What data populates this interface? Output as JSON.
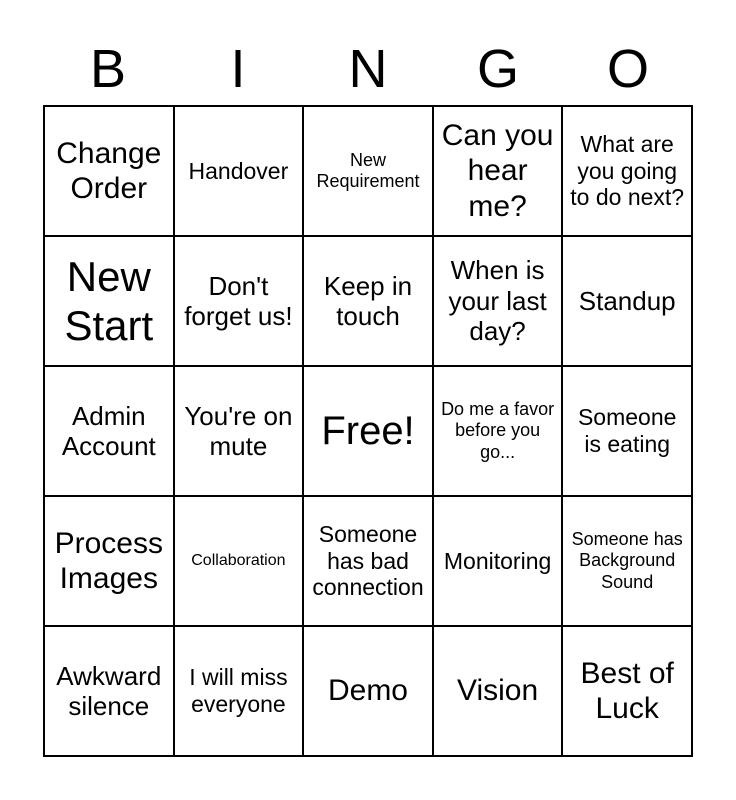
{
  "card": {
    "header_letters": [
      "B",
      "I",
      "N",
      "G",
      "O"
    ],
    "rows": [
      [
        {
          "text": "Change Order",
          "size": "lg"
        },
        {
          "text": "Handover",
          "size": "sm"
        },
        {
          "text": "New Requirement",
          "size": "xs"
        },
        {
          "text": "Can you hear me?",
          "size": "lg"
        },
        {
          "text": "What are you going to do next?",
          "size": "sm"
        }
      ],
      [
        {
          "text": "New Start",
          "size": "xxl"
        },
        {
          "text": "Don't forget us!",
          "size": "md"
        },
        {
          "text": "Keep in touch",
          "size": "md"
        },
        {
          "text": "When is your last day?",
          "size": "md"
        },
        {
          "text": "Standup",
          "size": "md"
        }
      ],
      [
        {
          "text": "Admin Account",
          "size": "md"
        },
        {
          "text": "You're on mute",
          "size": "md"
        },
        {
          "text": "Free!",
          "size": "xl"
        },
        {
          "text": "Do me a favor before you go...",
          "size": "xs"
        },
        {
          "text": "Someone is eating",
          "size": "sm"
        }
      ],
      [
        {
          "text": "Process Images",
          "size": "lg"
        },
        {
          "text": "Collaboration",
          "size": "xxs"
        },
        {
          "text": "Someone has bad connection",
          "size": "sm"
        },
        {
          "text": "Monitoring",
          "size": "sm"
        },
        {
          "text": "Someone has Background Sound",
          "size": "xs"
        }
      ],
      [
        {
          "text": "Awkward silence",
          "size": "md"
        },
        {
          "text": "I will miss everyone",
          "size": "sm"
        },
        {
          "text": "Demo",
          "size": "lg"
        },
        {
          "text": "Vision",
          "size": "lg"
        },
        {
          "text": "Best of Luck",
          "size": "lg"
        }
      ]
    ]
  },
  "colors": {
    "background": "#ffffff",
    "text": "#000000",
    "grid_line": "#000000"
  }
}
